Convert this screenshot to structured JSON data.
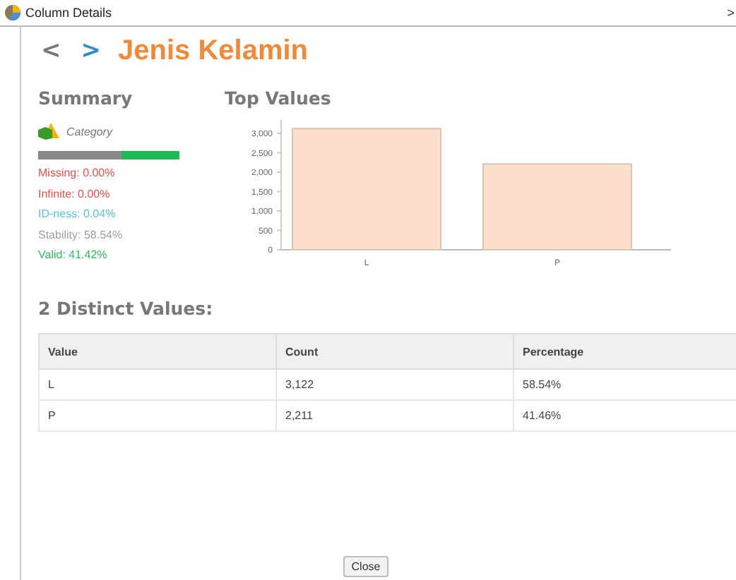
{
  "window": {
    "title": "Column Details",
    "edge_glyph": ">"
  },
  "header": {
    "back": "<",
    "forward": ">",
    "title": "Jenis Kelamin"
  },
  "summary": {
    "heading": "Summary",
    "type_label": "Category",
    "quality_bar": {
      "level": 0.585
    },
    "stats": [
      {
        "text": "Missing: 0.00%",
        "color": "#d9534f"
      },
      {
        "text": "Infinite: 0.00%",
        "color": "#d9534f"
      },
      {
        "text": "ID-ness: 0.04%",
        "color": "#5bc0de"
      },
      {
        "text": "Stability: 58.54%",
        "color": "#a0a0a0"
      },
      {
        "text": "Valid: 41.42%",
        "color": "#2eb85c"
      }
    ]
  },
  "top_values": {
    "heading": "Top Values",
    "chart_data": {
      "type": "bar",
      "categories": [
        "L",
        "P"
      ],
      "values": [
        3122,
        2211
      ],
      "ylim": [
        0,
        3200
      ],
      "yticks": [
        {
          "value": 0,
          "label": "0"
        },
        {
          "value": 500,
          "label": "500"
        },
        {
          "value": 1000,
          "label": "1,000"
        },
        {
          "value": 1500,
          "label": "1,500"
        },
        {
          "value": 2000,
          "label": "2,000"
        },
        {
          "value": 2500,
          "label": "2,500"
        },
        {
          "value": 3000,
          "label": "3,000"
        }
      ]
    }
  },
  "distinct": {
    "heading": "2 Distinct Values:",
    "columns": [
      "Value",
      "Count",
      "Percentage"
    ],
    "rows": [
      [
        "L",
        "3,122",
        "58.54%"
      ],
      [
        "P",
        "2,211",
        "41.46%"
      ]
    ]
  },
  "buttons": [
    "Close"
  ]
}
